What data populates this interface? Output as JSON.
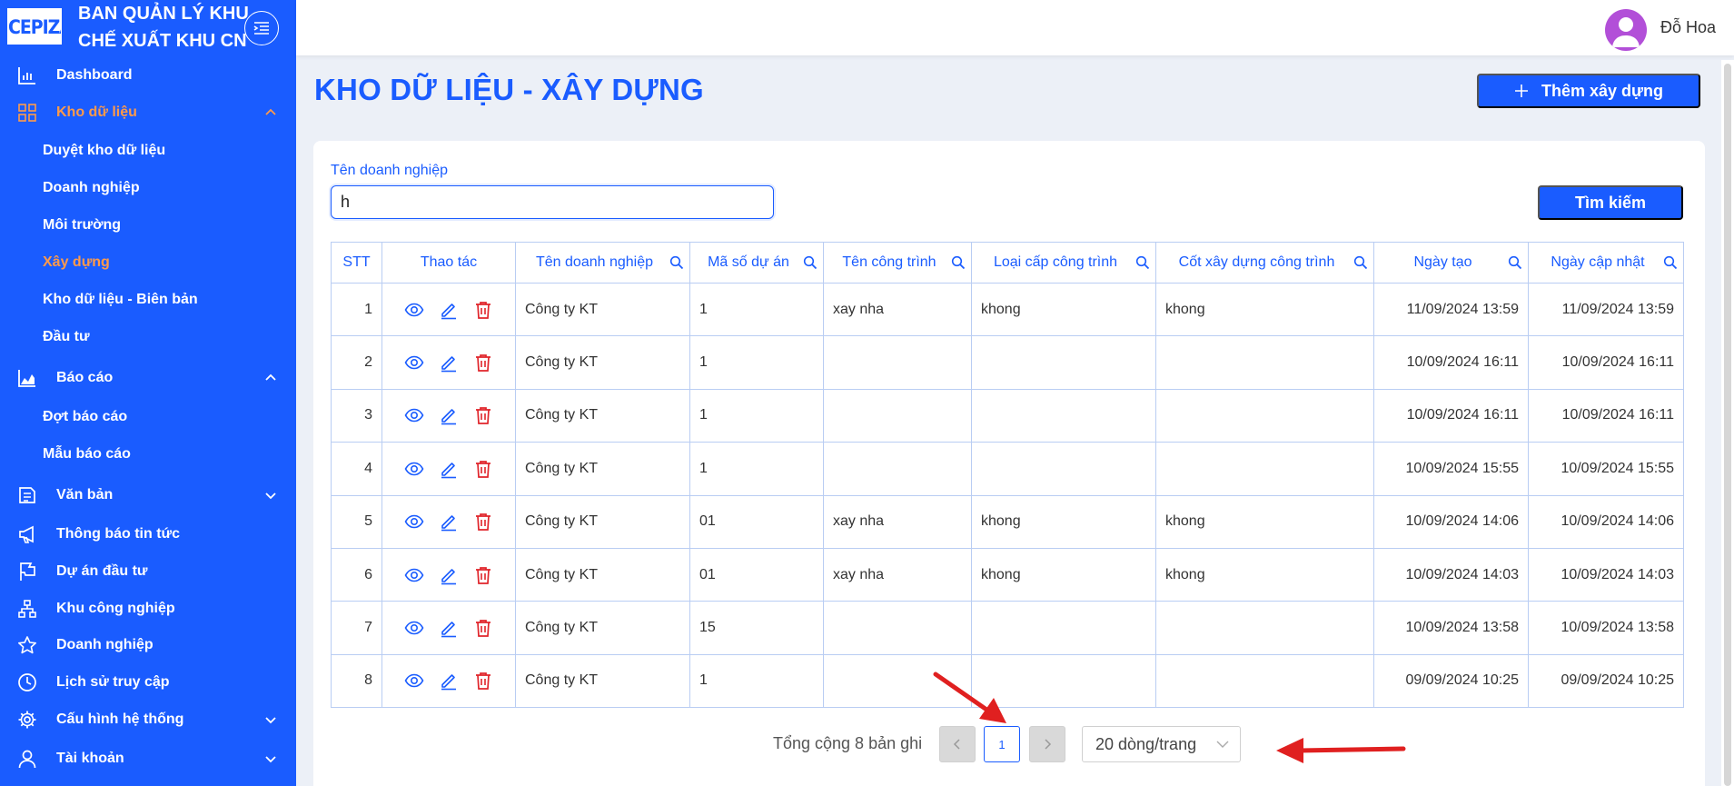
{
  "brand": {
    "logo_text": "CEPIZA",
    "title_line1": "BAN QUẢN LÝ KHU",
    "title_line2": "CHẾ XUẤT KHU CN"
  },
  "sidebar": {
    "items": [
      {
        "label": "Dashboard",
        "icon": "chart-bar-icon"
      },
      {
        "label": "Kho dữ liệu",
        "icon": "grid-icon",
        "active": true,
        "expanded": true
      },
      {
        "label": "Báo cáo",
        "icon": "area-chart-icon",
        "expanded": true
      },
      {
        "label": "Văn bản",
        "icon": "document-icon"
      },
      {
        "label": "Thông báo tin tức",
        "icon": "megaphone-icon"
      },
      {
        "label": "Dự án đầu tư",
        "icon": "flag-icon"
      },
      {
        "label": "Khu công nghiệp",
        "icon": "cluster-icon"
      },
      {
        "label": "Doanh nghiệp",
        "icon": "star-icon"
      },
      {
        "label": "Lịch sử truy cập",
        "icon": "clock-icon"
      },
      {
        "label": "Cấu hình hệ thống",
        "icon": "gear-icon"
      },
      {
        "label": "Tài khoản",
        "icon": "user-icon"
      }
    ],
    "kho_sub": [
      "Duyệt kho dữ liệu",
      "Doanh nghiệp",
      "Môi trường",
      "Xây dựng",
      "Kho dữ liệu - Biên bản",
      "Đầu tư"
    ],
    "bao_cao_sub": [
      "Đợt báo cáo",
      "Mẫu báo cáo"
    ]
  },
  "header": {
    "username": "Đỗ Hoa"
  },
  "page": {
    "title": "KHO DỮ LIỆU - XÂY DỰNG",
    "add_button": "Thêm xây dựng",
    "filter_label": "Tên doanh nghiệp",
    "filter_value": "h",
    "search_button": "Tìm kiếm"
  },
  "table": {
    "headers": [
      "STT",
      "Thao tác",
      "Tên doanh nghiệp",
      "Mã số dự án",
      "Tên công trình",
      "Loại cấp công trình",
      "Cốt xây dựng công trình",
      "Ngày tạo",
      "Ngày cập nhật"
    ],
    "rows": [
      {
        "stt": "1",
        "company": "Công ty KT",
        "project_code": "1",
        "work_name": "xay nha",
        "work_level": "khong",
        "elevation": "khong",
        "created": "11/09/2024 13:59",
        "updated": "11/09/2024 13:59"
      },
      {
        "stt": "2",
        "company": "Công ty KT",
        "project_code": "1",
        "work_name": "",
        "work_level": "",
        "elevation": "",
        "created": "10/09/2024 16:11",
        "updated": "10/09/2024 16:11"
      },
      {
        "stt": "3",
        "company": "Công ty KT",
        "project_code": "1",
        "work_name": "",
        "work_level": "",
        "elevation": "",
        "created": "10/09/2024 16:11",
        "updated": "10/09/2024 16:11"
      },
      {
        "stt": "4",
        "company": "Công ty KT",
        "project_code": "1",
        "work_name": "",
        "work_level": "",
        "elevation": "",
        "created": "10/09/2024 15:55",
        "updated": "10/09/2024 15:55"
      },
      {
        "stt": "5",
        "company": "Công ty KT",
        "project_code": "01",
        "work_name": "xay nha",
        "work_level": "khong",
        "elevation": "khong",
        "created": "10/09/2024 14:06",
        "updated": "10/09/2024 14:06"
      },
      {
        "stt": "6",
        "company": "Công ty KT",
        "project_code": "01",
        "work_name": "xay nha",
        "work_level": "khong",
        "elevation": "khong",
        "created": "10/09/2024 14:03",
        "updated": "10/09/2024 14:03"
      },
      {
        "stt": "7",
        "company": "Công ty KT",
        "project_code": "15",
        "work_name": "",
        "work_level": "",
        "elevation": "",
        "created": "10/09/2024 13:58",
        "updated": "10/09/2024 13:58"
      },
      {
        "stt": "8",
        "company": "Công ty KT",
        "project_code": "1",
        "work_name": "",
        "work_level": "",
        "elevation": "",
        "created": "09/09/2024 10:25",
        "updated": "09/09/2024 10:25"
      }
    ]
  },
  "pagination": {
    "total_text": "Tổng cộng 8 bản ghi",
    "current_page": "1",
    "page_size": "20 dòng/trang"
  },
  "colors": {
    "primary": "#1a5cff",
    "active": "#ff9a4a",
    "delete": "#e0242a",
    "annotation_arrow": "#e02020"
  }
}
